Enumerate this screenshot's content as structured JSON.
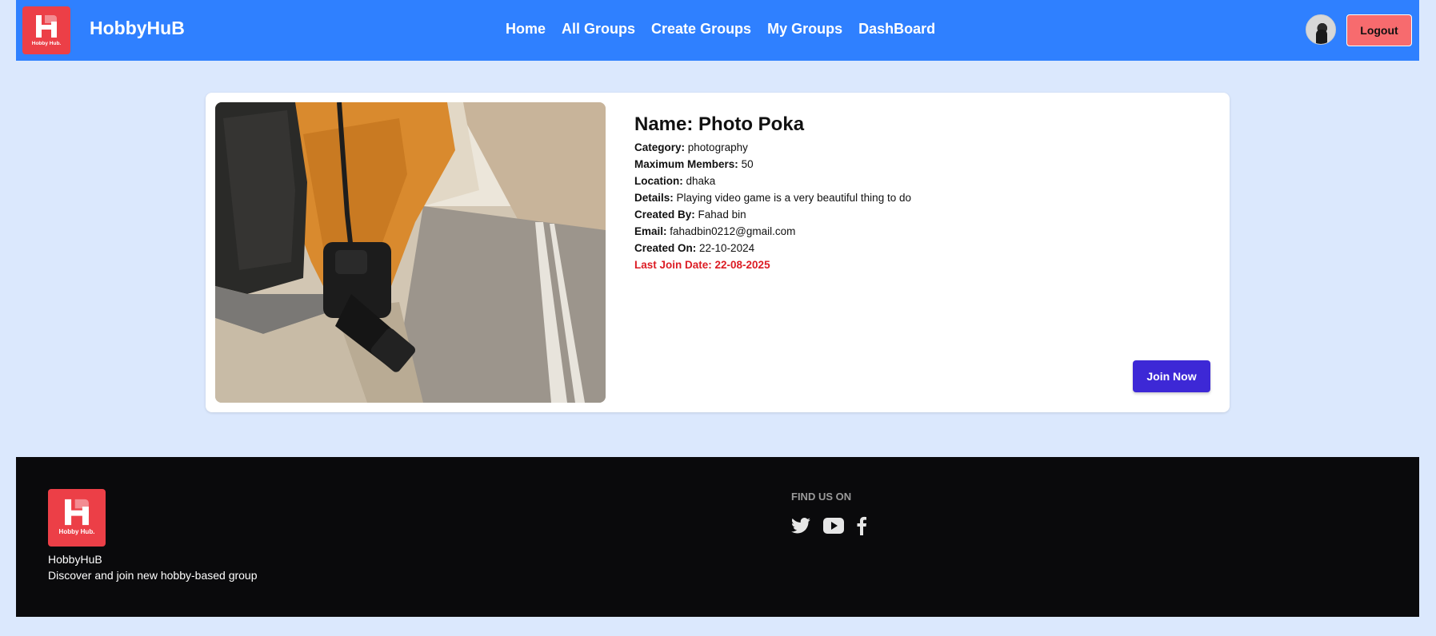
{
  "navbar": {
    "logo_text": "Hobby Hub.",
    "brand": "HobbyHuB",
    "links": [
      "Home",
      "All Groups",
      "Create Groups",
      "My Groups",
      "DashBoard"
    ],
    "logout_label": "Logout",
    "bg_color": "#2f80ff"
  },
  "group": {
    "name": "Name: Photo Poka",
    "category_label": "Category:",
    "category": "photography",
    "max_members_label": "Maximum Members:",
    "max_members": "50",
    "location_label": "Location:",
    "location": "dhaka",
    "details_label": "Details:",
    "details": "Playing video game is a very beautiful thing to do",
    "created_by_label": "Created By:",
    "created_by": "Fahad bin",
    "email_label": "Email:",
    "email": "fahadbin0212@gmail.com",
    "created_on_label": "Created On:",
    "created_on": "22-10-2024",
    "last_join": "Last Join Date: 22-08-2025",
    "join_label": "Join Now"
  },
  "footer": {
    "logo_text": "Hobby Hub.",
    "brand": "HobbyHuB",
    "tagline": "Discover and join new hobby-based group",
    "find_us": "FIND US ON",
    "social_icons": [
      "twitter-icon",
      "youtube-icon",
      "facebook-icon"
    ]
  },
  "colors": {
    "page_bg": "#dbe8fd",
    "accent_red": "#ec3f47",
    "join_button": "#3d28d6",
    "last_join_text": "#dc1c24",
    "footer_bg": "#0a0a0c"
  }
}
